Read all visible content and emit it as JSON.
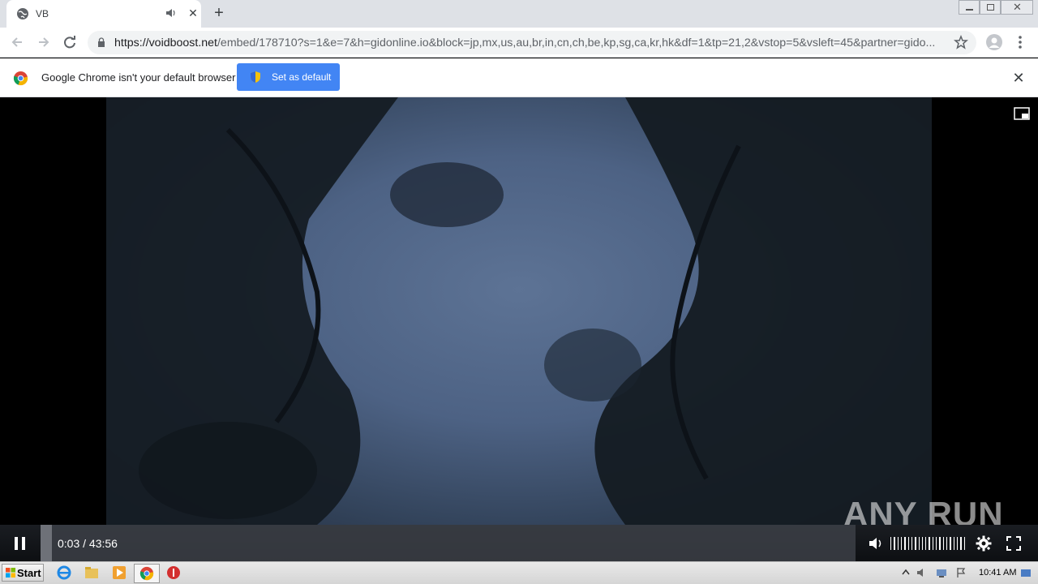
{
  "browser": {
    "tab_title": "VB",
    "url_host": "https://voidboost.net",
    "url_path": "/embed/178710?s=1&e=7&h=gidonline.io&block=jp,mx,us,au,br,in,cn,ch,be,kp,sg,ca,kr,hk&df=1&tp=21,2&vstop=5&vsleft=45&partner=gido..."
  },
  "infobar": {
    "message": "Google Chrome isn't your default browser",
    "button_label": "Set as default"
  },
  "player": {
    "time_display": "0:03 / 43:56",
    "progress_fraction": 0.0011,
    "volume_bars": 22,
    "watermark": "ANY RUN"
  },
  "taskbar": {
    "start_label": "Start",
    "clock": "10:41 AM"
  },
  "colors": {
    "accent_button": "#4285f4",
    "tabstrip": "#dee1e6"
  }
}
